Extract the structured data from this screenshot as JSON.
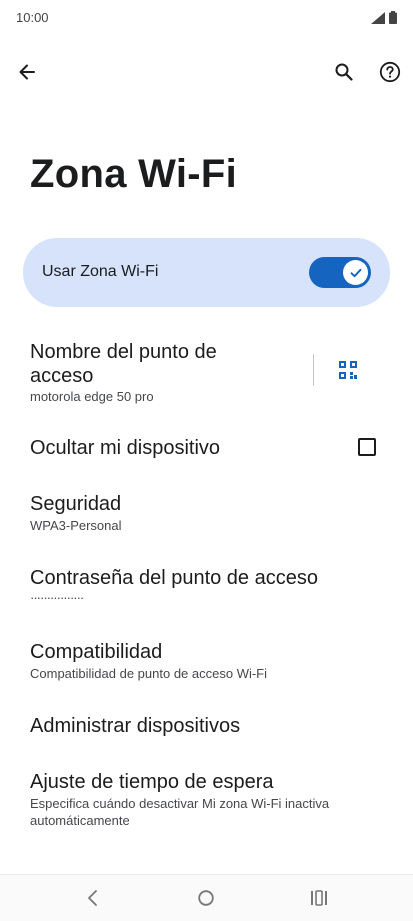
{
  "status_bar": {
    "time": "10:00",
    "icons": [
      "signal-icon",
      "battery-icon"
    ]
  },
  "toolbar": {
    "back_icon": "arrow-back-icon",
    "search_icon": "search-icon",
    "help_icon": "help-icon"
  },
  "page": {
    "title": "Zona Wi-Fi"
  },
  "master_switch": {
    "label": "Usar Zona Wi-Fi",
    "checked": true,
    "accent": "#1565c0",
    "background": "#d6e3fb"
  },
  "preferences": [
    {
      "title_line1": "Nombre del punto de",
      "title_line2": "acceso",
      "summary": "motorola edge 50 pro",
      "action_icon": "qr-code-icon"
    },
    {
      "title": "Ocultar mi dispositivo",
      "checked": false
    },
    {
      "title": "Seguridad",
      "summary": "WPA3-Personal"
    },
    {
      "title": "Contraseña del punto de acceso",
      "summary": "················"
    },
    {
      "title": "Compatibilidad",
      "summary": "Compatibilidad de punto de acceso Wi-Fi"
    },
    {
      "title": "Administrar dispositivos"
    },
    {
      "title": "Ajuste de tiempo de espera",
      "summary_line1": "Especifica cuándo desactivar Mi zona Wi-Fi inactiva",
      "summary_line2": "automáticamente"
    }
  ],
  "nav_bar": {
    "back_icon": "nav-back-icon",
    "home_icon": "nav-home-icon",
    "recents_icon": "nav-recents-icon"
  }
}
